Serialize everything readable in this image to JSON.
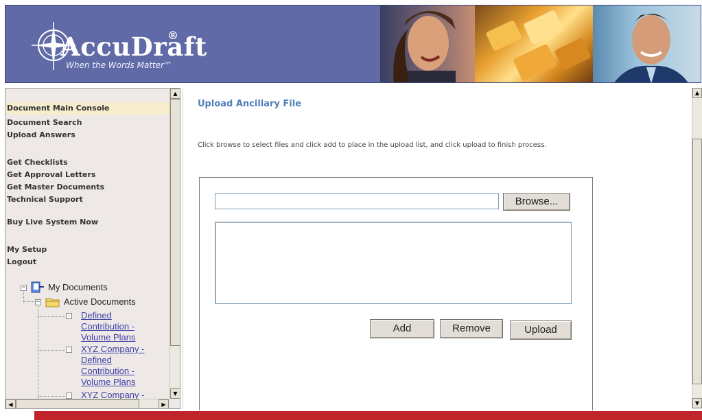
{
  "header": {
    "brand_name": "AccuDraft",
    "brand_mark": "®",
    "tagline": "When the Words Matter™",
    "colors": {
      "band": "#5f6aa6"
    }
  },
  "sidebar": {
    "nav_items": [
      {
        "label": "Document Main Console",
        "active": true
      },
      {
        "label": "Document Search",
        "active": false
      },
      {
        "label": "Upload Answers",
        "active": false
      },
      {
        "label": "Get Checklists",
        "active": false
      },
      {
        "label": "Get Approval Letters",
        "active": false
      },
      {
        "label": "Get Master Documents",
        "active": false
      },
      {
        "label": "Technical Support",
        "active": false
      },
      {
        "label": "Buy Live System Now",
        "active": false
      },
      {
        "label": "My Setup",
        "active": false
      },
      {
        "label": "Logout",
        "active": false
      }
    ],
    "tree": {
      "root_label": "My Documents",
      "folder_label": "Active Documents",
      "documents": [
        {
          "lines": [
            "Defined",
            "Contribution -",
            "Volume Plans"
          ]
        },
        {
          "lines": [
            "XYZ Company -",
            "Defined",
            "Contribution -",
            "Volume Plans"
          ]
        },
        {
          "lines": [
            "XYZ Company -"
          ]
        }
      ]
    }
  },
  "main": {
    "title": "Upload Ancillary File",
    "instructions": "Click browse to select files and click add to place in the upload list, and click upload to finish process.",
    "file_input_value": "",
    "buttons": {
      "browse": "Browse...",
      "add": "Add",
      "remove": "Remove",
      "upload": "Upload"
    }
  },
  "icons": {
    "logo": "compass-star-logo",
    "tree_root": "document-stack-icon",
    "tree_folder": "folder-icon",
    "collapse": "minus-box-icon",
    "doc_node": "dot-box-icon"
  },
  "colors": {
    "accent_title": "#4f7fb8",
    "link": "#3e3ea8",
    "footer": "#c2242c",
    "active_nav_bg": "#f5edcc"
  }
}
